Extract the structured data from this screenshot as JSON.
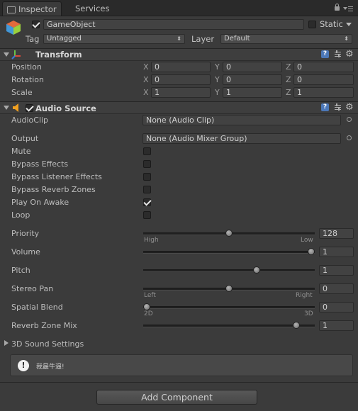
{
  "tabs": [
    {
      "label": "Inspector"
    },
    {
      "label": "Services"
    }
  ],
  "gameobject": {
    "name": "GameObject",
    "active": true,
    "static_label": "Static",
    "tag_label": "Tag",
    "tag_value": "Untagged",
    "layer_label": "Layer",
    "layer_value": "Default"
  },
  "transform": {
    "title": "Transform",
    "rows": [
      {
        "label": "Position",
        "x": "0",
        "y": "0",
        "z": "0"
      },
      {
        "label": "Rotation",
        "x": "0",
        "y": "0",
        "z": "0"
      },
      {
        "label": "Scale",
        "x": "1",
        "y": "1",
        "z": "1"
      }
    ],
    "axis": {
      "x": "X",
      "y": "Y",
      "z": "Z"
    }
  },
  "audio": {
    "title": "Audio Source",
    "enabled": true,
    "audioclip_label": "AudioClip",
    "audioclip_value": "None (Audio Clip)",
    "output_label": "Output",
    "output_value": "None (Audio Mixer Group)",
    "toggles": [
      {
        "label": "Mute",
        "checked": false
      },
      {
        "label": "Bypass Effects",
        "checked": false
      },
      {
        "label": "Bypass Listener Effects",
        "checked": false
      },
      {
        "label": "Bypass Reverb Zones",
        "checked": false
      },
      {
        "label": "Play On Awake",
        "checked": true
      },
      {
        "label": "Loop",
        "checked": false
      }
    ],
    "sliders": [
      {
        "label": "Priority",
        "value": "128",
        "fraction": 0.5,
        "left": "High",
        "right": "Low"
      },
      {
        "label": "Volume",
        "value": "1",
        "fraction": 1.0
      },
      {
        "label": "Pitch",
        "value": "1",
        "fraction": 0.667
      },
      {
        "label": "Stereo Pan",
        "value": "0",
        "fraction": 0.5,
        "left": "Left",
        "right": "Right"
      },
      {
        "label": "Spatial Blend",
        "value": "0",
        "fraction": 0.0,
        "left": "2D",
        "right": "3D"
      },
      {
        "label": "Reverb Zone Mix",
        "value": "1",
        "fraction": 0.909
      }
    ],
    "sound3d_label": "3D Sound Settings"
  },
  "message": {
    "text": "我最牛逼!"
  },
  "add_component": {
    "label": "Add Component"
  },
  "colors": {
    "panel": "#3b3b3b",
    "audio_icon": "#f0a020"
  },
  "icons": [
    "lock-icon",
    "menu-icon",
    "cube-icon",
    "transform-gizmo-icon",
    "help-icon",
    "preset-icon",
    "gear-icon",
    "speaker-icon",
    "object-picker-icon",
    "info-icon"
  ]
}
